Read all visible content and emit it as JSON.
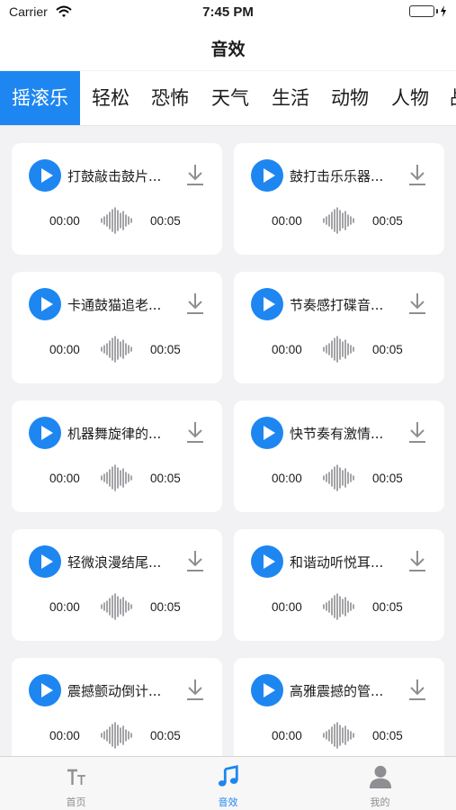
{
  "status": {
    "carrier": "Carrier",
    "time": "7:45 PM"
  },
  "nav": {
    "title": "音效"
  },
  "tabs": [
    {
      "label": "摇滚乐",
      "active": true
    },
    {
      "label": "轻松"
    },
    {
      "label": "恐怖"
    },
    {
      "label": "天气"
    },
    {
      "label": "生活"
    },
    {
      "label": "动物"
    },
    {
      "label": "人物"
    },
    {
      "label": "战"
    }
  ],
  "sounds": [
    {
      "name": "打鼓敲击鼓片...",
      "start": "00:00",
      "end": "00:05"
    },
    {
      "name": "鼓打击乐乐器...",
      "start": "00:00",
      "end": "00:05"
    },
    {
      "name": "卡通鼓猫追老...",
      "start": "00:00",
      "end": "00:05"
    },
    {
      "name": "节奏感打碟音...",
      "start": "00:00",
      "end": "00:05"
    },
    {
      "name": "机器舞旋律的...",
      "start": "00:00",
      "end": "00:05"
    },
    {
      "name": "快节奏有激情...",
      "start": "00:00",
      "end": "00:05"
    },
    {
      "name": "轻微浪漫结尾...",
      "start": "00:00",
      "end": "00:05"
    },
    {
      "name": "和谐动听悦耳...",
      "start": "00:00",
      "end": "00:05"
    },
    {
      "name": "震撼颤动倒计...",
      "start": "00:00",
      "end": "00:05"
    },
    {
      "name": "高雅震撼的管...",
      "start": "00:00",
      "end": "00:05"
    }
  ],
  "tabbar": [
    {
      "label": "首页",
      "icon": "text-size-icon"
    },
    {
      "label": "音效",
      "icon": "music-note-icon",
      "active": true
    },
    {
      "label": "我的",
      "icon": "person-icon"
    }
  ],
  "colors": {
    "accent": "#1e86f0",
    "background": "#f2f2f4"
  }
}
